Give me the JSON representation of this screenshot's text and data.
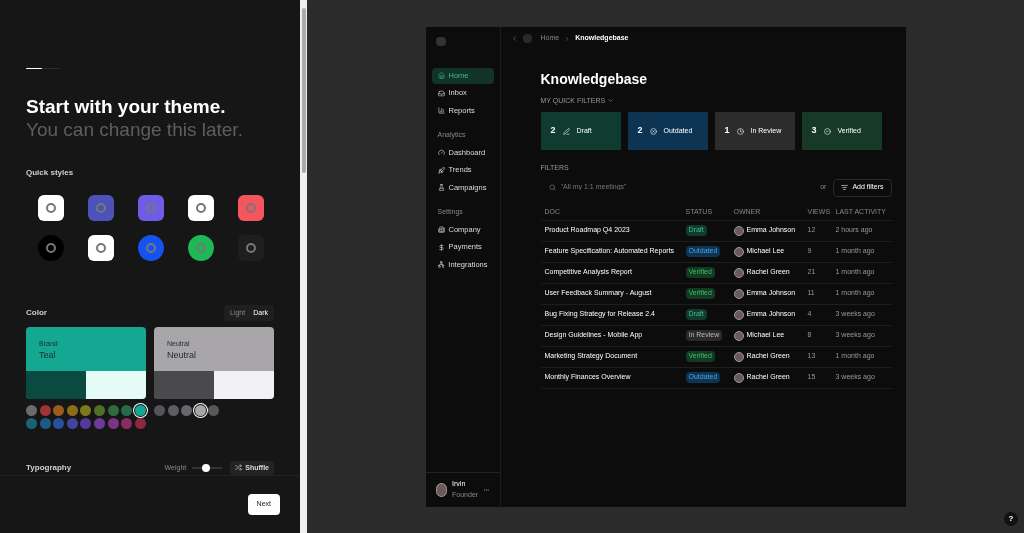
{
  "onboarding": {
    "progress": {
      "level": 0.47
    },
    "title": "Start with your theme.",
    "subtitle": "You can change this later.",
    "quick_styles": {
      "label": "Quick styles",
      "items": [
        {
          "color": "#ffffff",
          "kind": "square"
        },
        {
          "color": "#4c52b8",
          "kind": "square"
        },
        {
          "color": "#6f5ce6",
          "kind": "square"
        },
        {
          "color": "#ffffff",
          "kind": "square"
        },
        {
          "color": "#f5565d",
          "kind": "square"
        },
        {
          "color": "#000000",
          "kind": "circle"
        },
        {
          "color": "#ffffff",
          "kind": "square"
        },
        {
          "color": "#1652f0",
          "kind": "circle"
        },
        {
          "color": "#1db954",
          "kind": "circle"
        },
        {
          "color": "#1e1e1e",
          "kind": "square"
        }
      ]
    },
    "color": {
      "label": "Color",
      "modes": [
        {
          "label": "Light",
          "selected": false
        },
        {
          "label": "Dark",
          "selected": true
        }
      ],
      "cards": [
        {
          "label": "Brand",
          "name": "Teal",
          "color": "#14a893",
          "shades": [
            {
              "color": "#0b4a41"
            },
            {
              "color": "#e4fbf6"
            }
          ]
        },
        {
          "label": "Neutral",
          "name": "Neutral",
          "color": "#a8a6a9",
          "shades": [
            {
              "color": "#4a494b"
            },
            {
              "color": "#f2f1f3"
            }
          ]
        }
      ],
      "brand_swatches": [
        {
          "color": "#6b6b6b",
          "selected": false
        },
        {
          "color": "#a03434",
          "selected": false
        },
        {
          "color": "#9c5a1f",
          "selected": false
        },
        {
          "color": "#8f6d14",
          "selected": false
        },
        {
          "color": "#7a7a1c",
          "selected": false
        },
        {
          "color": "#4f7026",
          "selected": false
        },
        {
          "color": "#2f6b3c",
          "selected": false
        },
        {
          "color": "#2a6a4c",
          "selected": false
        },
        {
          "color": "#14a893",
          "selected": true
        },
        {
          "color": "#1c6273",
          "selected": false
        },
        {
          "color": "#1e5a86",
          "selected": false
        },
        {
          "color": "#2850a0",
          "selected": false
        },
        {
          "color": "#3f44a0",
          "selected": false
        },
        {
          "color": "#55389c",
          "selected": false
        },
        {
          "color": "#703a9c",
          "selected": false
        },
        {
          "color": "#7e3386",
          "selected": false
        },
        {
          "color": "#8a2c64",
          "selected": false
        },
        {
          "color": "#8e2840",
          "selected": false
        }
      ],
      "neutral_swatches": [
        {
          "color": "#555458",
          "selected": false
        },
        {
          "color": "#5e5d61",
          "selected": false
        },
        {
          "color": "#67666a",
          "selected": false
        },
        {
          "color": "#a8a6a9",
          "selected": true
        },
        {
          "color": "#58575a",
          "selected": false
        }
      ]
    },
    "typography": {
      "label": "Typography",
      "weight_label": "Weight",
      "weight": {
        "level": 0.45
      },
      "shuffle": "Shuffle"
    },
    "next": "Next"
  },
  "preview": {
    "breadcrumb": [
      "Home",
      "Knowledgebase"
    ],
    "sidebar": {
      "groups": [
        {
          "items": [
            {
              "label": "Home",
              "selected": true
            },
            {
              "label": "Inbox",
              "selected": false
            },
            {
              "label": "Reports",
              "selected": false
            }
          ]
        },
        {
          "heading": "Analytics",
          "items": [
            {
              "label": "Dashboard",
              "selected": false
            },
            {
              "label": "Trends",
              "selected": false
            },
            {
              "label": "Campaigns",
              "selected": false
            }
          ]
        },
        {
          "heading": "Settings",
          "items": [
            {
              "label": "Company",
              "selected": false
            },
            {
              "label": "Payments",
              "selected": false
            },
            {
              "label": "Integrations",
              "selected": false
            }
          ]
        }
      ],
      "user": {
        "name": "Irvin",
        "role": "Founder"
      }
    },
    "title": "Knowledgebase",
    "quick_filters_label": "MY QUICK FILTERS",
    "quick_filters": [
      {
        "count": "2",
        "label": "Draft",
        "kind": "draft"
      },
      {
        "count": "2",
        "label": "Outdated",
        "kind": "outdated"
      },
      {
        "count": "1",
        "label": "In Review",
        "kind": "review"
      },
      {
        "count": "3",
        "label": "Verified",
        "kind": "verified"
      }
    ],
    "filters_label": "FILTERS",
    "search_placeholder": "\"All my 1:1 meetings\"",
    "or": "or",
    "add_filters": "Add filters",
    "columns": [
      "DOC",
      "STATUS",
      "OWNER",
      "VIEWS",
      "LAST ACTIVITY"
    ],
    "rows": [
      {
        "doc": "Product Roadmap Q4 2023",
        "status": "Draft",
        "kind": "draft",
        "owner": "Emma Johnson",
        "views": "12",
        "last": "2 hours ago"
      },
      {
        "doc": "Feature Specification: Automated Reports",
        "status": "Outdated",
        "kind": "outdated",
        "owner": "Michael Lee",
        "views": "9",
        "last": "1 month ago"
      },
      {
        "doc": "Competitive Analysis Report",
        "status": "Verified",
        "kind": "verified",
        "owner": "Rachel Green",
        "views": "21",
        "last": "1 month ago"
      },
      {
        "doc": "User Feedback Summary - August",
        "status": "Verified",
        "kind": "verified",
        "owner": "Emma Johnson",
        "views": "11",
        "last": "1 month ago"
      },
      {
        "doc": "Bug Fixing Strategy for Release 2.4",
        "status": "Draft",
        "kind": "draft",
        "owner": "Emma Johnson",
        "views": "4",
        "last": "3 weeks ago"
      },
      {
        "doc": "Design Guidelines - Mobile App",
        "status": "In Review",
        "kind": "review",
        "owner": "Michael Lee",
        "views": "8",
        "last": "3 weeks ago"
      },
      {
        "doc": "Marketing Strategy Document",
        "status": "Verified",
        "kind": "verified",
        "owner": "Rachel Green",
        "views": "13",
        "last": "1 month ago"
      },
      {
        "doc": "Monthly Finances Overview",
        "status": "Outdated",
        "kind": "outdated",
        "owner": "Rachel Green",
        "views": "15",
        "last": "3 weeks ago"
      }
    ]
  },
  "help": "?"
}
